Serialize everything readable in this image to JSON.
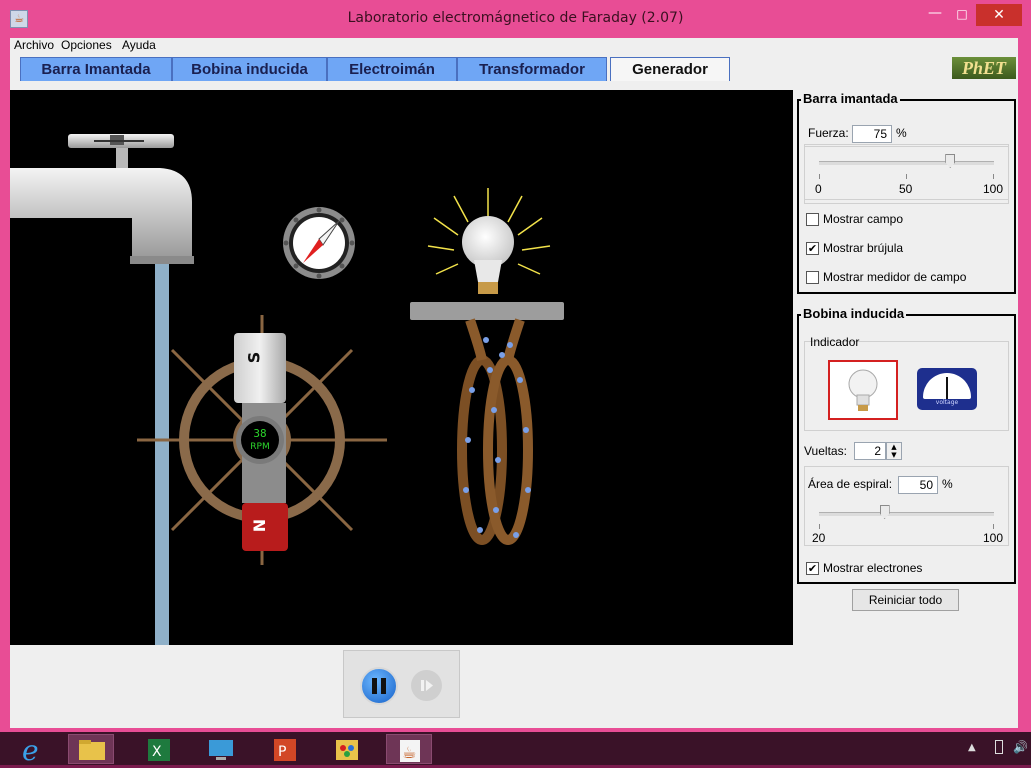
{
  "window": {
    "title": "Laboratorio electromágnetico de Faraday (2.07)"
  },
  "menu": [
    "Archivo",
    "Opciones",
    "Ayuda"
  ],
  "tabs": [
    {
      "label": "Barra Imantada"
    },
    {
      "label": "Bobina inducida"
    },
    {
      "label": "Electroimán"
    },
    {
      "label": "Transformador"
    },
    {
      "label": "Generador",
      "active": true
    }
  ],
  "logo": "PhET",
  "sim": {
    "rpm_value": "38",
    "rpm_unit": "RPM",
    "pole_s": "S",
    "pole_n": "N"
  },
  "barra": {
    "title": "Barra imantada",
    "fuerza_label": "Fuerza:",
    "fuerza_value": "75",
    "percent": "%",
    "slider_fraction": 0.75,
    "min": "0",
    "mid": "50",
    "max": "100",
    "mostrar_campo": {
      "label": "Mostrar campo",
      "checked": false
    },
    "mostrar_brujula": {
      "label": "Mostrar brújula",
      "checked": true
    },
    "mostrar_medidor": {
      "label": "Mostrar medidor de campo",
      "checked": false
    }
  },
  "bobina": {
    "title": "Bobina inducida",
    "indicador_label": "Indicador",
    "voltmeter_label": "voltage",
    "vueltas_label": "Vueltas:",
    "vueltas_value": "2",
    "area_label": "Área de espiral:",
    "area_value": "50",
    "percent": "%",
    "area_fraction": 0.375,
    "min": "20",
    "max": "100",
    "mostrar_electrones": {
      "label": "Mostrar electrones",
      "checked": true
    }
  },
  "reset_label": "Reiniciar todo",
  "colors": {
    "accent_tab": "#6fa6f5",
    "frame": "#e84d95",
    "close": "#c9302c"
  }
}
